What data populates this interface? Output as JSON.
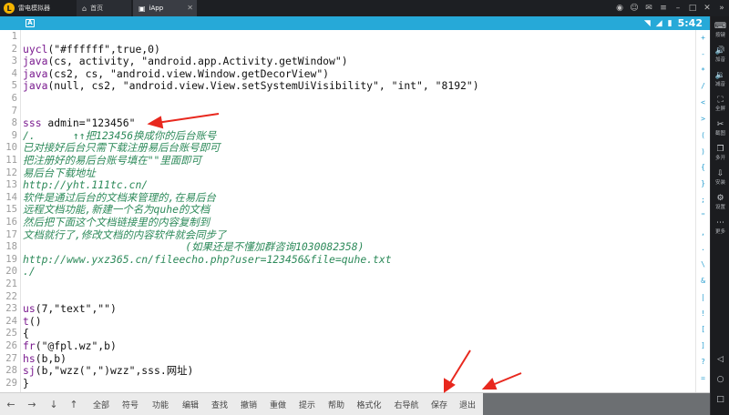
{
  "window": {
    "app_name": "雷电模拟器",
    "logo_glyph": "L",
    "tabs": [
      {
        "label": "首页",
        "glyph": "⌂"
      },
      {
        "label": "iApp",
        "glyph": "▣"
      }
    ]
  },
  "statusbar": {
    "notification": "A",
    "time": "5:42"
  },
  "editor": {
    "lines": [
      {
        "n": "1",
        "t": "",
        "kind": "code"
      },
      {
        "n": "2",
        "t": "uycl(\"#ffffff\",true,0)",
        "kind": "code"
      },
      {
        "n": "3",
        "t": "java(cs, activity, \"android.app.Activity.getWindow\")",
        "kind": "code"
      },
      {
        "n": "4",
        "t": "java(cs2, cs, \"android.view.Window.getDecorView\")",
        "kind": "code"
      },
      {
        "n": "5",
        "t": "java(null, cs2, \"android.view.View.setSystemUiVisibility\", \"int\", \"8192\")",
        "kind": "code"
      },
      {
        "n": "6",
        "t": "",
        "kind": "code"
      },
      {
        "n": "7",
        "t": "",
        "kind": "code"
      },
      {
        "n": "8",
        "t": "sss admin=\"123456\"",
        "kind": "code"
      },
      {
        "n": "9",
        "t": "/.      ↑↑把123456换成你的后台账号",
        "kind": "cm"
      },
      {
        "n": "10",
        "t": "已对接好后台只需下载注册易后台账号即可",
        "kind": "cm"
      },
      {
        "n": "11",
        "t": "把注册好的易后台账号填在\"\"里面即可",
        "kind": "cm"
      },
      {
        "n": "12",
        "t": "易后台下载地址",
        "kind": "cm"
      },
      {
        "n": "13",
        "t": "http://yht.111tc.cn/",
        "kind": "cm"
      },
      {
        "n": "14",
        "t": "软件是通过后台的文档来管理的,在易后台",
        "kind": "cm"
      },
      {
        "n": "15",
        "t": "远程文档功能,新建一个名为quhe的文档",
        "kind": "cm"
      },
      {
        "n": "16",
        "t": "然后把下面这个文档链接里的内容复制到",
        "kind": "cm"
      },
      {
        "n": "17",
        "t": "文档就行了,修改文档的内容软件就会同步了",
        "kind": "cm"
      },
      {
        "n": "18",
        "t": "                          (如果还是不懂加群咨询1030082358)",
        "kind": "cm"
      },
      {
        "n": "19",
        "t": "http://www.yxz365.cn/fileecho.php?user=123456&file=quhe.txt",
        "kind": "cm"
      },
      {
        "n": "20",
        "t": "./",
        "kind": "cm"
      },
      {
        "n": "21",
        "t": "",
        "kind": "code"
      },
      {
        "n": "22",
        "t": "",
        "kind": "code"
      },
      {
        "n": "23",
        "t": "us(7,\"text\",\"\")",
        "kind": "code"
      },
      {
        "n": "24",
        "t": "t()",
        "kind": "code"
      },
      {
        "n": "25",
        "t": "{",
        "kind": "code"
      },
      {
        "n": "26",
        "t": "fr(\"@fpl.wz\",b)",
        "kind": "code"
      },
      {
        "n": "27",
        "t": "hs(b,b)",
        "kind": "code"
      },
      {
        "n": "28",
        "t": "sj(b,\"wzz(\",\")wzz\",sss.网址)",
        "kind": "code"
      },
      {
        "n": "29",
        "t": "}",
        "kind": "code"
      }
    ]
  },
  "symbols": [
    "+",
    "-",
    "*",
    "/",
    "<",
    ">",
    "(",
    ")",
    "{",
    "}",
    ";",
    "\"",
    ",",
    ".",
    "\\",
    "&",
    "|",
    "!",
    "[",
    "]",
    "?",
    "="
  ],
  "emulator_side": [
    {
      "label": "按键",
      "icon": "keyboard-icon",
      "glyph": "⌨"
    },
    {
      "label": "加音",
      "icon": "volume-up-icon",
      "glyph": "🔊"
    },
    {
      "label": "减音",
      "icon": "volume-down-icon",
      "glyph": "🔉"
    },
    {
      "label": "全屏",
      "icon": "fullscreen-icon",
      "glyph": "⛶"
    },
    {
      "label": "截图",
      "icon": "screenshot-icon",
      "glyph": "✂"
    },
    {
      "label": "多开",
      "icon": "multi-instance-icon",
      "glyph": "❐"
    },
    {
      "label": "安装",
      "icon": "install-icon",
      "glyph": "⇩"
    },
    {
      "label": "设置",
      "icon": "gear-icon",
      "glyph": "⚙"
    },
    {
      "label": "更多",
      "icon": "more-icon",
      "glyph": "⋯"
    }
  ],
  "bottombar": {
    "arrows": [
      "←",
      "→",
      "↓",
      "↑"
    ],
    "actions": [
      "全部",
      "符号",
      "功能",
      "编辑",
      "查找",
      "撤销",
      "重做",
      "提示",
      "帮助",
      "格式化",
      "右导航",
      "保存",
      "退出"
    ]
  }
}
